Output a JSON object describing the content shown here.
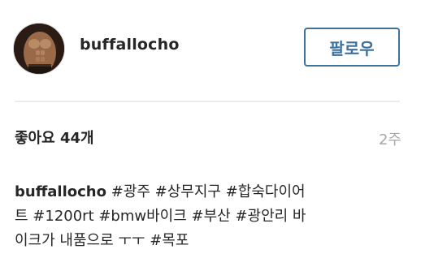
{
  "post": {
    "username": "buffallocho",
    "follow_label": "팔로우",
    "likes_text": "좋아요 44개",
    "time_ago": "2주",
    "caption": {
      "author": "buffallocho",
      "line1": "#광주 #상무지구 #합숙다이어",
      "line2": "트 #1200rt #bmw바이크 #부산 #광안리 바",
      "line3": "이크가 내품으로 ㅜㅜ #목포"
    }
  },
  "colors": {
    "follow_accent": "#3f729b",
    "text": "#262626",
    "muted": "#a5a7aa",
    "divider": "#ececec"
  },
  "icons": {
    "avatar": "profile-photo"
  }
}
